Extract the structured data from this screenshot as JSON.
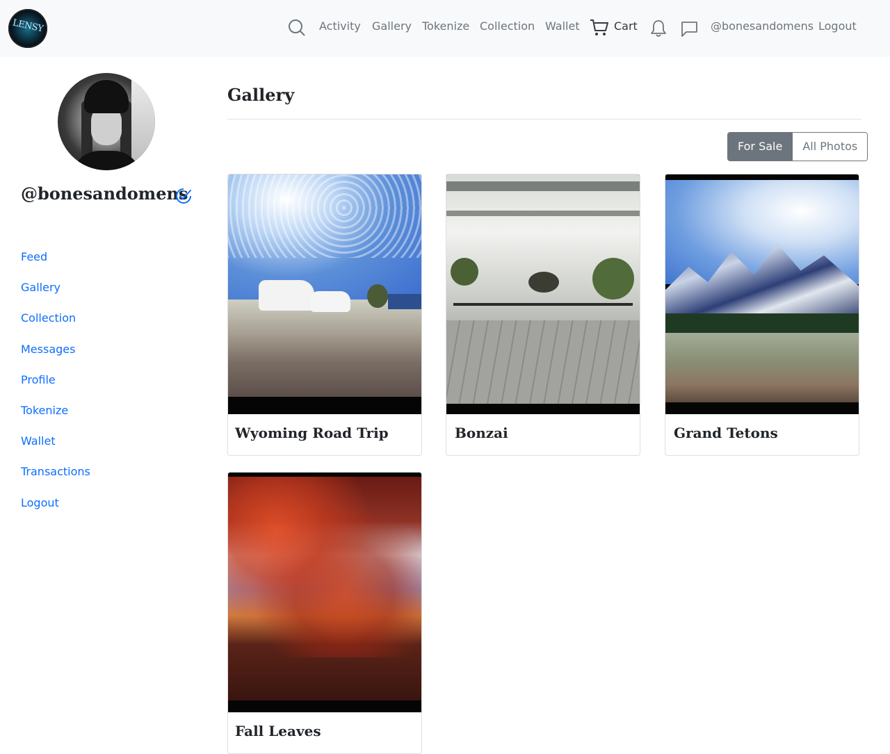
{
  "brand": {
    "logo_text": "LENSY"
  },
  "nav": {
    "items": [
      "Activity",
      "Gallery",
      "Tokenize",
      "Collection",
      "Wallet"
    ],
    "cart_label": "Cart",
    "user": "@bonesandomens",
    "logout": "Logout",
    "icons": [
      "search-icon",
      "cart-icon",
      "bell-icon",
      "message-icon"
    ]
  },
  "profile": {
    "username": "@bonesandomens",
    "verified": true
  },
  "sidebar": {
    "links": [
      "Feed",
      "Gallery",
      "Collection",
      "Messages",
      "Profile",
      "Tokenize",
      "Wallet",
      "Transactions",
      "Logout"
    ]
  },
  "main": {
    "title": "Gallery",
    "filter": {
      "options": [
        "For Sale",
        "All Photos"
      ],
      "selected": "For Sale"
    },
    "photos": [
      {
        "title": "Wyoming Road Trip"
      },
      {
        "title": "Bonzai"
      },
      {
        "title": "Grand Tetons"
      },
      {
        "title": "Fall Leaves"
      }
    ]
  },
  "colors": {
    "link": "#0d6efd",
    "nav_text": "#6c757d",
    "topbar_bg": "#f8f9fa",
    "active_button": "#6c757d"
  }
}
